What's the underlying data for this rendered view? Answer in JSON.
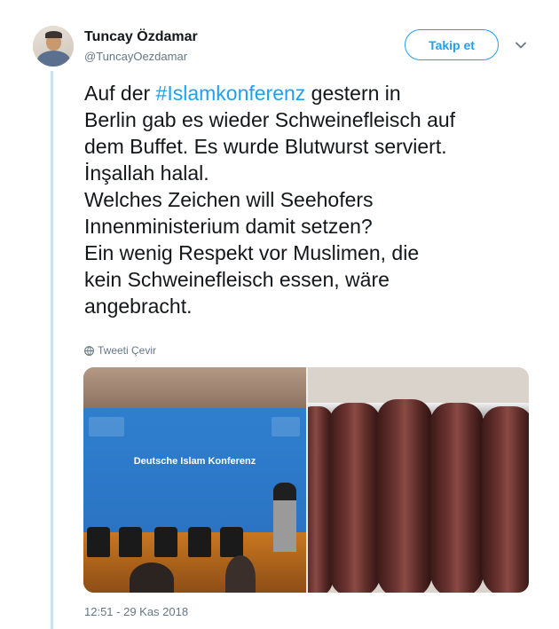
{
  "author": {
    "name": "Tuncay Özdamar",
    "handle": "@TuncayOezdamar"
  },
  "follow_button": {
    "label": "Takip et"
  },
  "tweet": {
    "lines": [
      {
        "pre": "Auf der ",
        "hashtag": "#Islamkonferenz",
        "post": " gestern in"
      },
      {
        "text": "Berlin gab es wieder Schweinefleisch auf"
      },
      {
        "text": "dem Buffet. Es wurde Blutwurst serviert."
      },
      {
        "text": "İnşallah halal."
      },
      {
        "text": "Welches Zeichen will Seehofers"
      },
      {
        "text": "Innenministerium damit setzen?"
      },
      {
        "text": "Ein wenig Respekt vor Muslimen, die"
      },
      {
        "text": "kein Schweinefleisch essen, wäre"
      },
      {
        "text": "angebracht."
      }
    ],
    "translate_label": "Tweeti Çevir",
    "timestamp": "12:51 - 29 Kas 2018"
  },
  "media": {
    "left_photo": {
      "banner_text": "Deutsche Islam Konferenz"
    },
    "right_photo": {}
  },
  "icons": {
    "globe": "globe-icon",
    "chevron": "chevron-down-icon"
  },
  "colors": {
    "accent": "#1da1f2",
    "secondary_text": "#657786",
    "thread_line": "#c5e3f7"
  }
}
